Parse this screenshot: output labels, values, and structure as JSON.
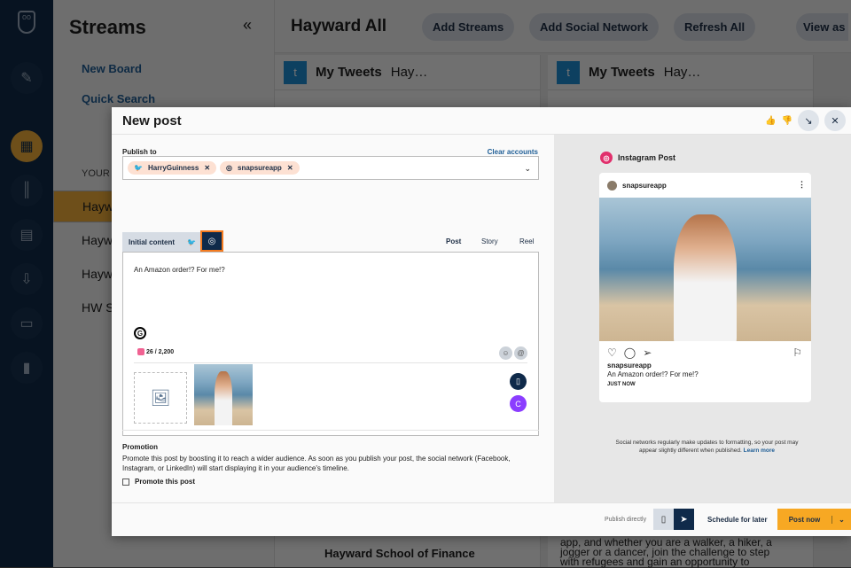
{
  "rail": {
    "icons": [
      "owl-logo-icon",
      "compose-icon",
      "streams-icon",
      "analytics-icon",
      "calendar-icon",
      "inbox-icon",
      "clipboard-icon",
      "reports-icon"
    ]
  },
  "sidebar": {
    "title": "Streams",
    "collapse": "«",
    "new_board": "New Board",
    "quick_search": "Quick Search",
    "your_boards": "YOUR BOARDS",
    "boards": [
      "Hayward All",
      "Hayward",
      "Hayward",
      "HW Social"
    ]
  },
  "topbar": {
    "title": "Hayward All",
    "add_streams": "Add Streams",
    "add_network": "Add Social Network",
    "refresh": "Refresh All",
    "view_as": "View as"
  },
  "streams": [
    {
      "title": "My Tweets",
      "sub": "Hay…"
    },
    {
      "title": "My Tweets",
      "sub": "Hay…"
    }
  ],
  "background_feed": {
    "author": "Hayward School of Finance",
    "snippet": [
      "app, and whether you are a walker, a hiker, a",
      "jogger or a dancer, join the challenge to step",
      "with refugees and gain an opportunity to"
    ]
  },
  "modal": {
    "title": "New post",
    "publish_to": "Publish to",
    "clear_accounts": "Clear accounts",
    "accounts": [
      {
        "network": "twitter",
        "name": "HarryGuinness"
      },
      {
        "network": "instagram",
        "name": "snapsureapp"
      }
    ],
    "initial_content": "Initial content",
    "post_types": [
      "Post",
      "Story",
      "Reel"
    ],
    "selected_post_type": "Post",
    "message": "An Amazon order!? For me!?",
    "char_count": "26 / 2,200",
    "promotion": {
      "title": "Promotion",
      "text": "Promote this post by boosting it to reach a wider audience. As soon as you publish your post, the social network (Facebook, Instagram, or LinkedIn) will start displaying it in your audience's timeline.",
      "checkbox": "Promote this post",
      "checked": false
    },
    "preview": {
      "title": "Instagram Post",
      "username": "snapsureapp",
      "caption": "An Amazon order!? For me!?",
      "time": "JUST NOW",
      "note": "Social networks regularly make updates to formatting, so your post may appear slightly different when published.",
      "learn_more": "Learn more"
    },
    "footer": {
      "publish_directly": "Publish directly",
      "schedule": "Schedule for later",
      "post_now": "Post now"
    }
  }
}
